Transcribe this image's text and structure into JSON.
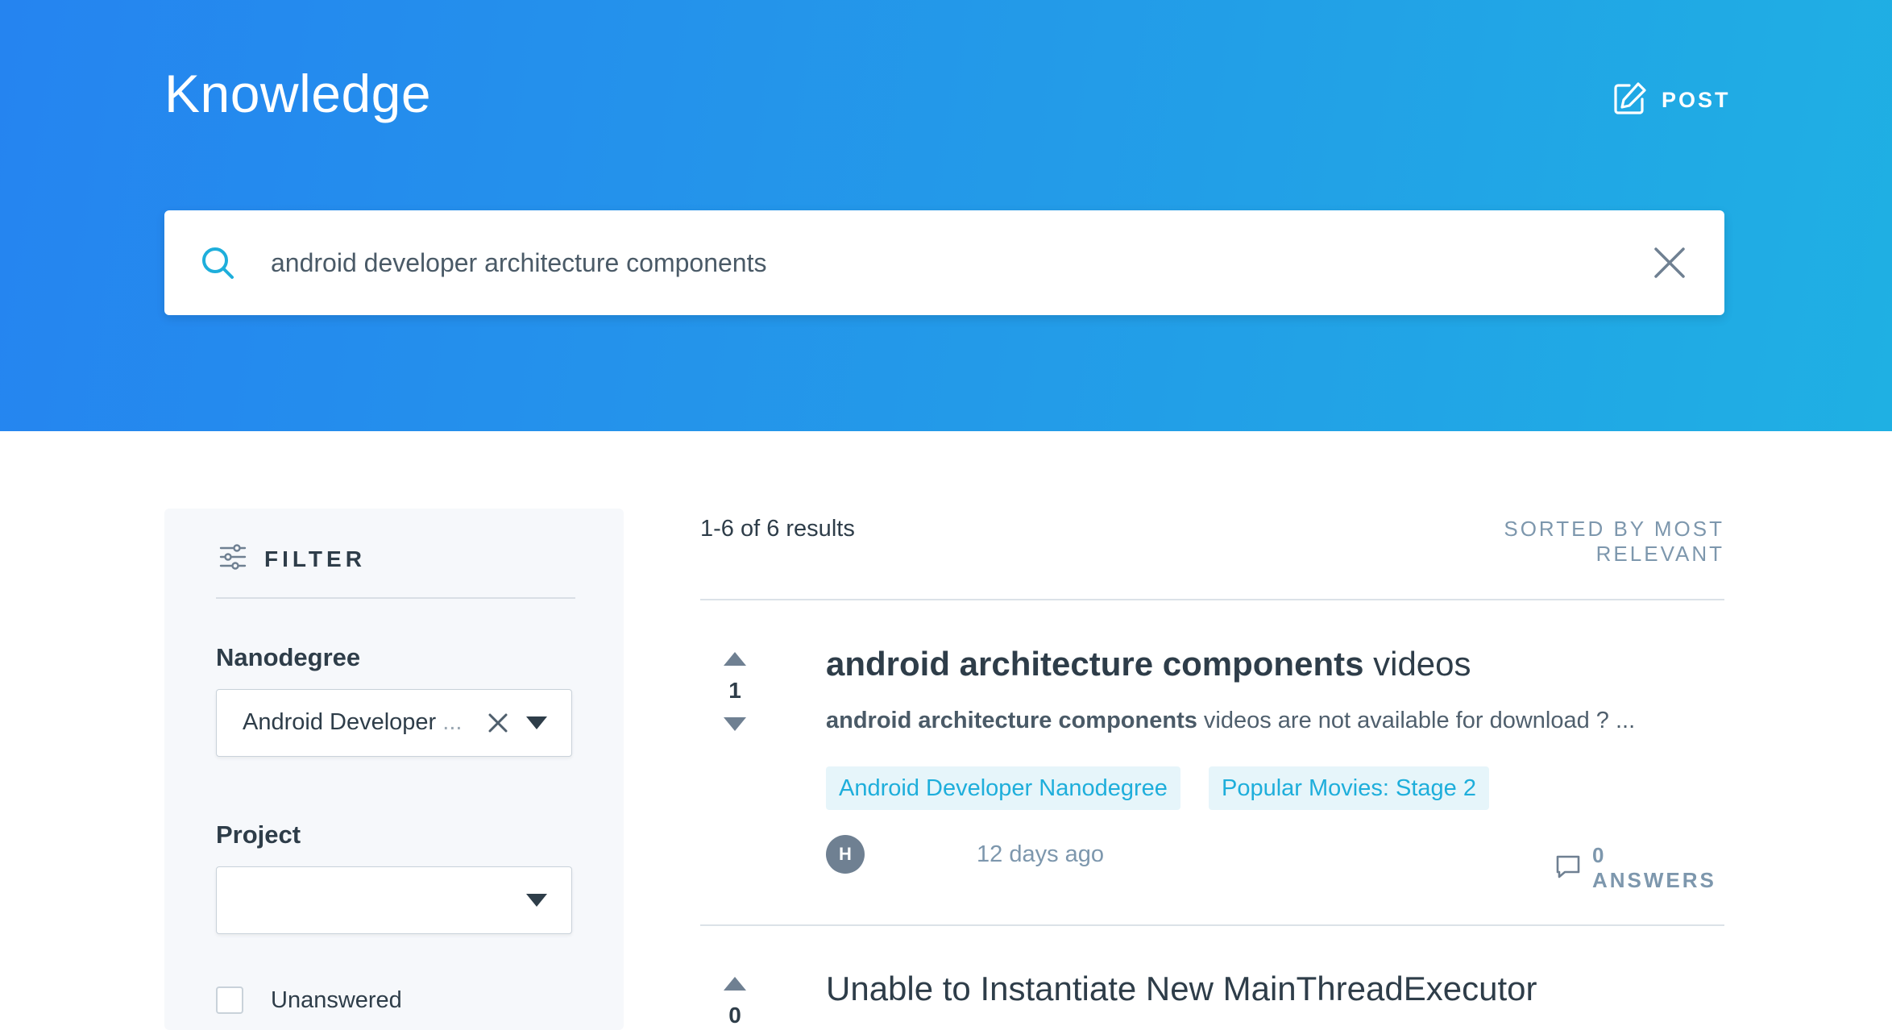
{
  "header": {
    "title": "Knowledge",
    "post_label": "POST"
  },
  "search": {
    "value": "android developer architecture components"
  },
  "filter": {
    "heading": "FILTER",
    "nanodegree_label": "Nanodegree",
    "nanodegree_value": "Android Developer",
    "nanodegree_ellipsis": "...",
    "project_label": "Project",
    "project_value": "",
    "unanswered_label": "Unanswered"
  },
  "results": {
    "count_text": "1-6 of 6 results",
    "sorted_text": "SORTED BY MOST RELEVANT",
    "items": [
      {
        "votes": "1",
        "title_bold": "android architecture components",
        "title_rest": " videos",
        "snippet_bold": "android architecture components",
        "snippet_rest": " videos are not available for download ? ...",
        "tags": [
          "Android Developer Nanodegree",
          "Popular Movies: Stage 2"
        ],
        "avatar_initial": "H",
        "time_ago": "12 days ago",
        "answers": "0 ANSWERS"
      },
      {
        "votes": "0",
        "title": "Unable to Instantiate New MainThreadExecutor"
      }
    ]
  },
  "colors": {
    "brand_gradient_start": "#2584f0",
    "brand_gradient_end": "#1fb0e3",
    "accent": "#1eaedb",
    "tag_bg": "#e6f5fa",
    "muted": "#7d97ad"
  }
}
